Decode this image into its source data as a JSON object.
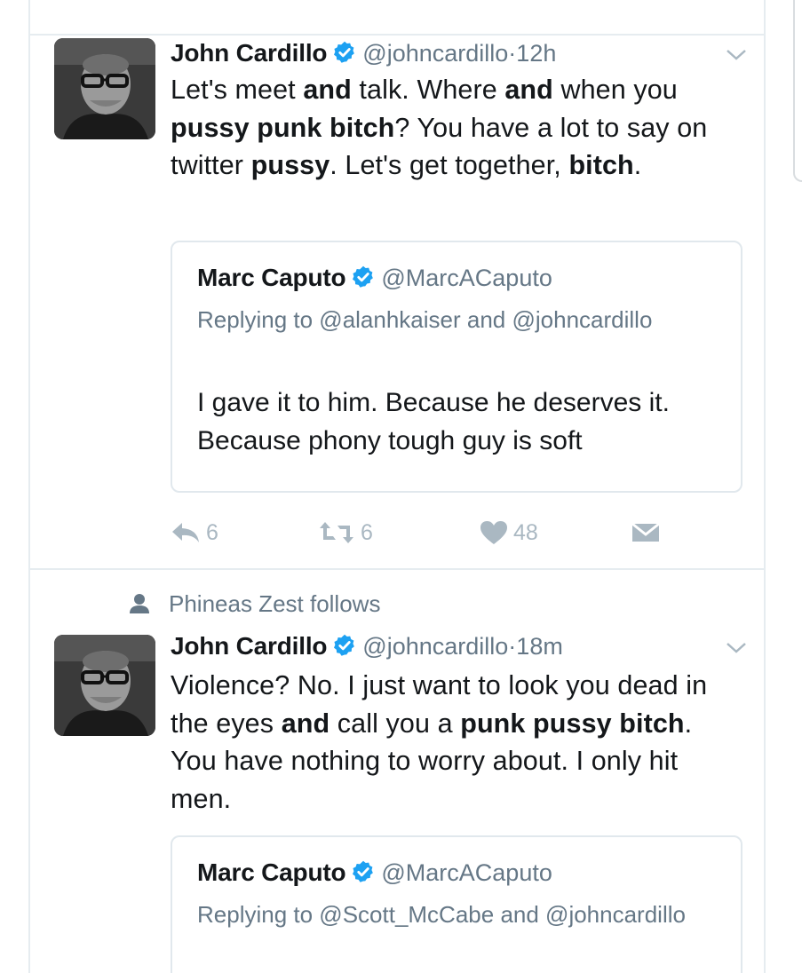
{
  "tweets": [
    {
      "author_name": "John Cardillo",
      "author_handle": "@johncardillo",
      "dot": "·",
      "time": "12h",
      "body_segments": [
        {
          "t": "Let's meet ",
          "b": false
        },
        {
          "t": "and",
          "b": true
        },
        {
          "t": " talk. Where ",
          "b": false
        },
        {
          "t": "and",
          "b": true
        },
        {
          "t": " when you ",
          "b": false
        },
        {
          "t": "pussy punk bitch",
          "b": true
        },
        {
          "t": "? You have a lot to say on twitter ",
          "b": false
        },
        {
          "t": "pussy",
          "b": true
        },
        {
          "t": ". Let's get together, ",
          "b": false
        },
        {
          "t": "bitch",
          "b": true
        },
        {
          "t": ".",
          "b": false
        }
      ],
      "quote": {
        "author_name": "Marc Caputo",
        "author_handle": "@MarcACaputo",
        "replying_to": "Replying to @alanhkaiser and @johncardillo",
        "text": "I gave it to him. Because he deserves it. Because phony tough guy is soft"
      },
      "actions": {
        "reply_count": "6",
        "retweet_count": "6",
        "like_count": "48"
      }
    },
    {
      "social_context": "Phineas Zest follows",
      "author_name": "John Cardillo",
      "author_handle": "@johncardillo",
      "dot": "·",
      "time": "18m",
      "body_segments": [
        {
          "t": "Violence? No. I just want to look you dead in the eyes ",
          "b": false
        },
        {
          "t": "and",
          "b": true
        },
        {
          "t": " call you a ",
          "b": false
        },
        {
          "t": "punk pussy bitch",
          "b": true
        },
        {
          "t": ". You have nothing to worry about. I only hit men.",
          "b": false
        }
      ],
      "quote": {
        "author_name": "Marc Caputo",
        "author_handle": "@MarcACaputo",
        "replying_to": "Replying to @Scott_McCabe and @johncardillo"
      }
    }
  ],
  "icons": {
    "verified": "verified-badge-icon",
    "reply": "reply-icon",
    "retweet": "retweet-icon",
    "like": "heart-icon",
    "dm": "envelope-icon",
    "caret": "chevron-down-icon",
    "person": "person-icon"
  },
  "colors": {
    "verified": "#1da1f2",
    "muted": "#657786",
    "action": "#aab8c2",
    "border": "#e1e8ed"
  }
}
